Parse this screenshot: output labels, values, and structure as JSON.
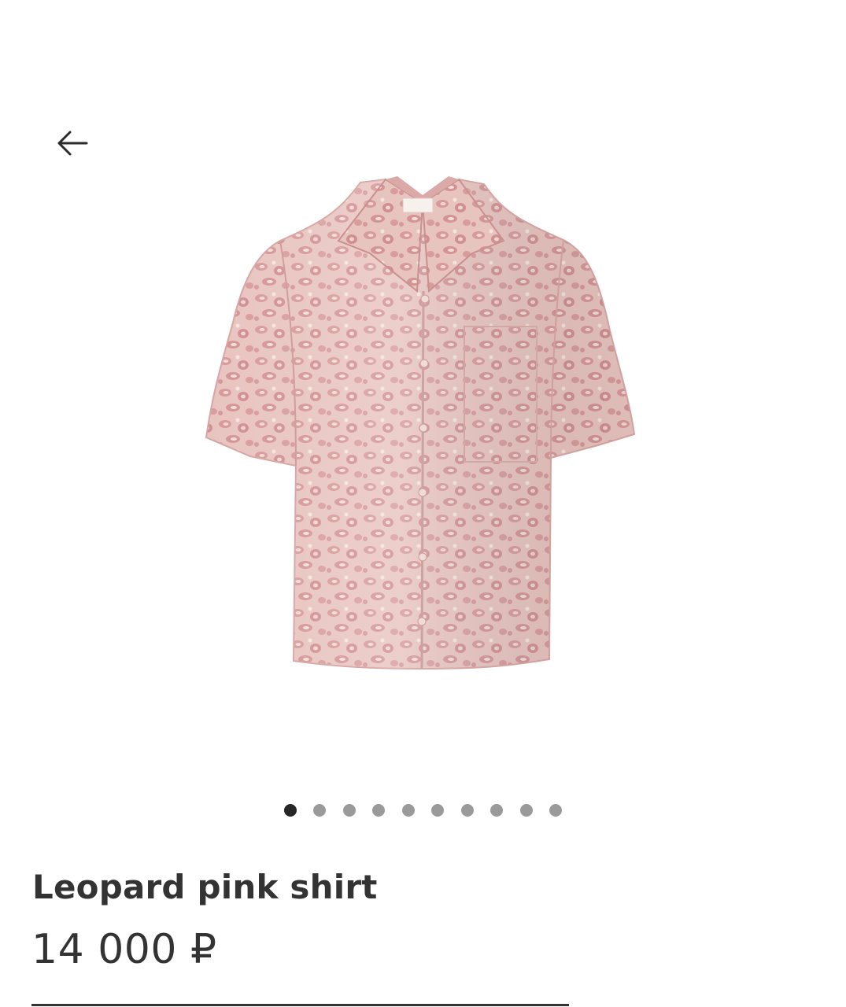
{
  "navigation": {
    "back_icon": "arrow-left-icon"
  },
  "gallery": {
    "image_subject": "pink leopard jacquard short-sleeve shirt",
    "total_images": 10,
    "active_index": 0,
    "shirt_color": "#e7bdb8",
    "pattern_color": "#cf8e8f"
  },
  "product": {
    "title": "Leopard pink shirt",
    "price": "14 000 ₽"
  },
  "colors": {
    "text": "#333333",
    "dot_inactive": "#9a9a9a",
    "dot_active": "#262626"
  }
}
